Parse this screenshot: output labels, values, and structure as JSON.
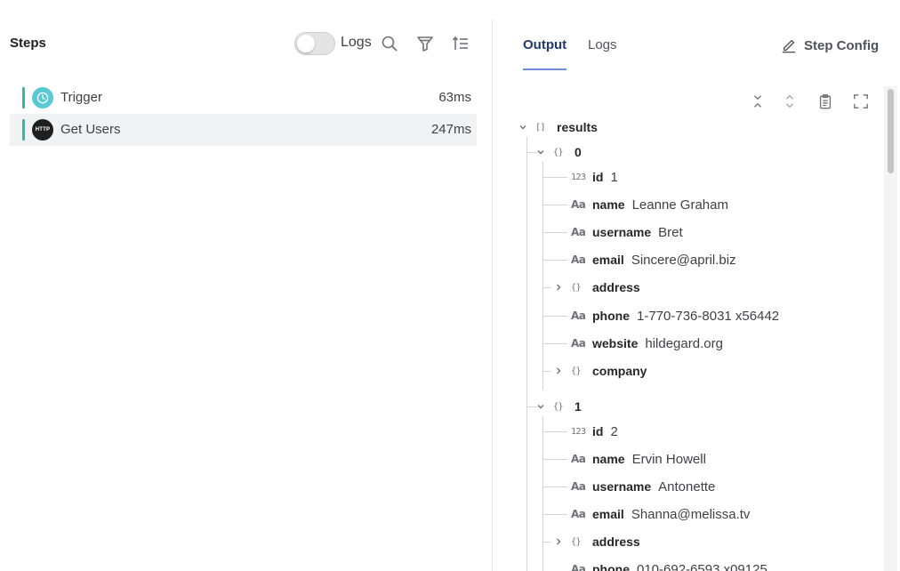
{
  "steps_panel": {
    "title": "Steps",
    "logs_toggle_label": "Logs",
    "steps": [
      {
        "label": "Trigger",
        "duration": "63ms",
        "icon": "clock-icon"
      },
      {
        "label": "Get Users",
        "duration": "247ms",
        "icon": "http-icon",
        "icon_text": "HTTP"
      }
    ]
  },
  "output_panel": {
    "tabs": [
      {
        "label": "Output"
      },
      {
        "label": "Logs"
      }
    ],
    "step_config_label": "Step Config",
    "tree": {
      "root_key": "results",
      "items": [
        {
          "index": "0",
          "fields": [
            {
              "key": "id",
              "value": "1",
              "type_icon": "123"
            },
            {
              "key": "name",
              "value": "Leanne Graham",
              "type_icon": "Aa"
            },
            {
              "key": "username",
              "value": "Bret",
              "type_icon": "Aa"
            },
            {
              "key": "email",
              "value": "Sincere@april.biz",
              "type_icon": "Aa"
            },
            {
              "key": "address",
              "value": "",
              "type_icon": "{}"
            },
            {
              "key": "phone",
              "value": "1-770-736-8031 x56442",
              "type_icon": "Aa"
            },
            {
              "key": "website",
              "value": "hildegard.org",
              "type_icon": "Aa"
            },
            {
              "key": "company",
              "value": "",
              "type_icon": "{}"
            }
          ]
        },
        {
          "index": "1",
          "fields": [
            {
              "key": "id",
              "value": "2",
              "type_icon": "123"
            },
            {
              "key": "name",
              "value": "Ervin Howell",
              "type_icon": "Aa"
            },
            {
              "key": "username",
              "value": "Antonette",
              "type_icon": "Aa"
            },
            {
              "key": "email",
              "value": "Shanna@melissa.tv",
              "type_icon": "Aa"
            },
            {
              "key": "address",
              "value": "",
              "type_icon": "{}"
            },
            {
              "key": "phone",
              "value": "010-692-6593 x09125",
              "type_icon": "Aa"
            }
          ]
        }
      ]
    }
  },
  "type_icons": {
    "array": "[]",
    "object": "{}",
    "number": "123",
    "string": "Aa"
  },
  "colors": {
    "accent": "#2bbf9d",
    "tab_active": "#1f3a6e",
    "tab_underline": "#6c8fd8",
    "selected_row": "#f0f2f4"
  }
}
